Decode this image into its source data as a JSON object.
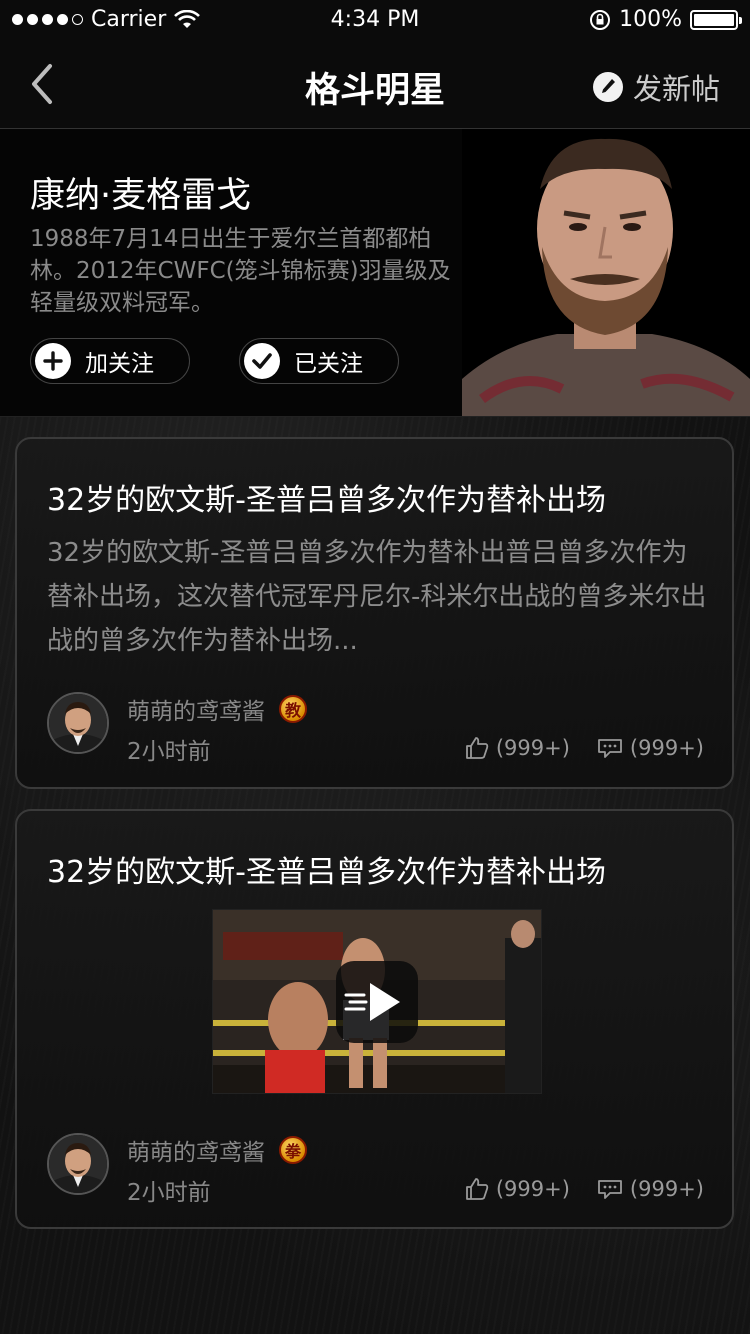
{
  "status_bar": {
    "carrier": "Carrier",
    "time": "4:34 PM",
    "battery": "100%"
  },
  "nav": {
    "title": "格斗明星",
    "new_post_label": "发新帖"
  },
  "profile": {
    "name": "康纳·麦格雷戈",
    "bio": "1988年7月14日出生于爱尔兰首都都柏林。2012年CWFC(笼斗锦标赛)羽量级及轻量级双料冠军。",
    "follow_label": "加关注",
    "followed_label": "已关注"
  },
  "posts": [
    {
      "title": "32岁的欧文斯-圣普吕曾多次作为替补出场",
      "excerpt": "32岁的欧文斯-圣普吕曾多次作为替补出普吕曾多次作为替补出场，这次替代冠军丹尼尔-科米尔出战的曾多米尔出战的曾多次作为替补出场...",
      "author": "萌萌的鸢鸢酱",
      "badge": "教",
      "time": "2小时前",
      "likes": "(999+)",
      "comments": "(999+)"
    },
    {
      "title": "32岁的欧文斯-圣普吕曾多次作为替补出场",
      "author": "萌萌的鸢鸢酱",
      "badge": "拳",
      "time": "2小时前",
      "likes": "(999+)",
      "comments": "(999+)"
    }
  ],
  "colors": {
    "background": "#0b0b0b",
    "card_border": "#3a3a3a",
    "muted_text": "#8c8c8c",
    "badge_gold": "#f0b020"
  }
}
